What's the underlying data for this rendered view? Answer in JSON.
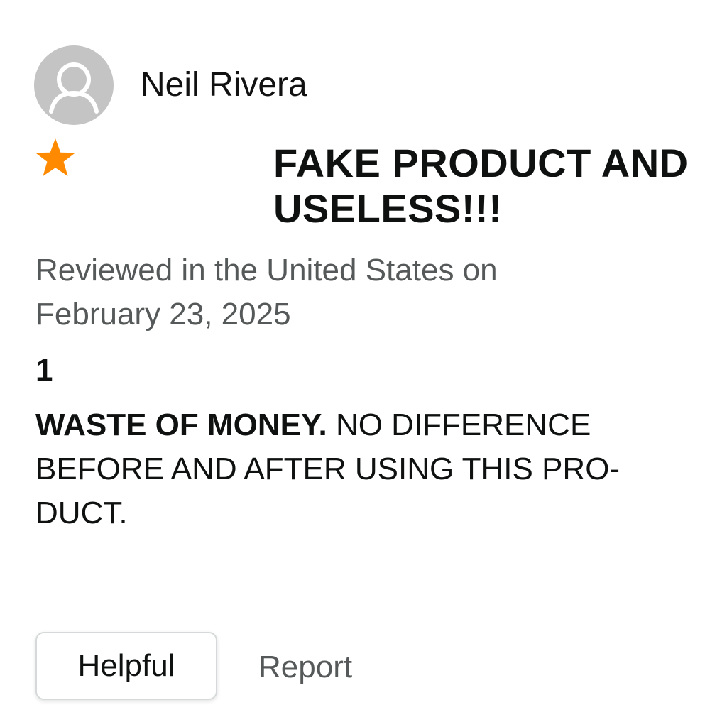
{
  "review": {
    "reviewer_name": "Neil Rivera",
    "avatar_icon": "user-silhouette-icon",
    "rating_icon": "star-icon",
    "star_color": "#ff8a00",
    "title_line1": "FAKE PRODUCT AND",
    "title_line2": "USELESS!!!",
    "meta_line1": "Reviewed in the United States on",
    "meta_line2": "February 23, 2025",
    "rating_count": "1",
    "body_lead": "WASTE OF MONEY.",
    "body_line1_rest": "NO DIFFERENCE",
    "body_line2": "BEFORE AND AFTER USING THIS PRO-",
    "body_line3": "DUCT."
  },
  "actions": {
    "helpful_label": "Helpful",
    "report_label": "Report"
  }
}
